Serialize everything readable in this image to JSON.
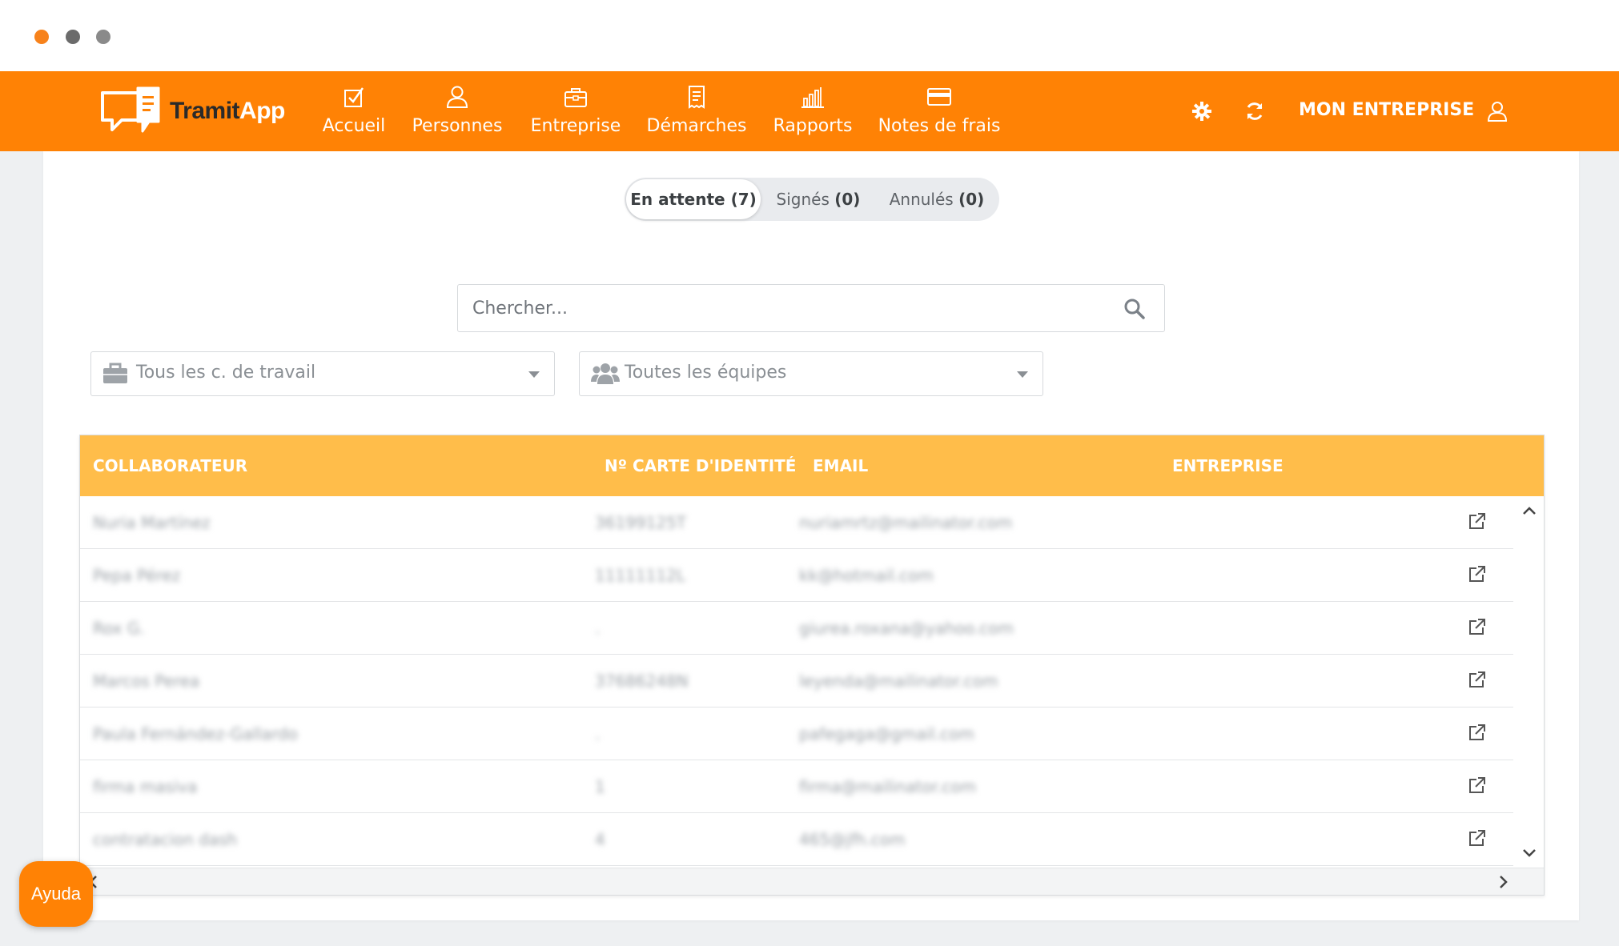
{
  "app": {
    "brand_part1": "Tramit",
    "brand_part2": "App",
    "accent_color": "#ff8205",
    "header_color": "#ffbd4a"
  },
  "nav": {
    "items": [
      {
        "label": "Accueil",
        "icon": "checkbox-icon"
      },
      {
        "label": "Personnes",
        "icon": "user-icon"
      },
      {
        "label": "Entreprise",
        "icon": "briefcase-icon"
      },
      {
        "label": "Démarches",
        "icon": "document-icon"
      },
      {
        "label": "Rapports",
        "icon": "bar-chart-icon"
      },
      {
        "label": "Notes de frais",
        "icon": "credit-card-icon"
      }
    ],
    "company_label": "MON ENTREPRISE"
  },
  "tabs": [
    {
      "label": "En attente",
      "count": "(7)"
    },
    {
      "label": "Signés",
      "count": "(0)"
    },
    {
      "label": "Annulés",
      "count": "(0)"
    }
  ],
  "search": {
    "placeholder": "Chercher..."
  },
  "filters": {
    "workplace": "Tous les c. de travail",
    "teams": "Toutes les équipes"
  },
  "table": {
    "headers": [
      "COLLABORATEUR",
      "Nº CARTE D'IDENTITÉ",
      "EMAIL",
      "ENTREPRISE"
    ],
    "rows": [
      {
        "name": "Nuria Martínez",
        "id": "36199125T",
        "email": "nuriamrtz@mailinator.com",
        "company": ""
      },
      {
        "name": "Pepa Pérez",
        "id": "11111112L",
        "email": "kk@hotmail.com",
        "company": ""
      },
      {
        "name": "Rox G.",
        "id": ".",
        "email": "giurea.roxana@yahoo.com",
        "company": ""
      },
      {
        "name": "Marcos Perea",
        "id": "37686248N",
        "email": "leyenda@mailinator.com",
        "company": ""
      },
      {
        "name": "Paula Fernández-Gallardo",
        "id": ".",
        "email": "pafegaga@gmail.com",
        "company": ""
      },
      {
        "name": "firma masiva",
        "id": "1",
        "email": "firma@mailinator.com",
        "company": ""
      },
      {
        "name": "contratacion dash",
        "id": "4",
        "email": "465@jfh.com",
        "company": ""
      }
    ]
  },
  "help": {
    "label": "Ayuda"
  }
}
